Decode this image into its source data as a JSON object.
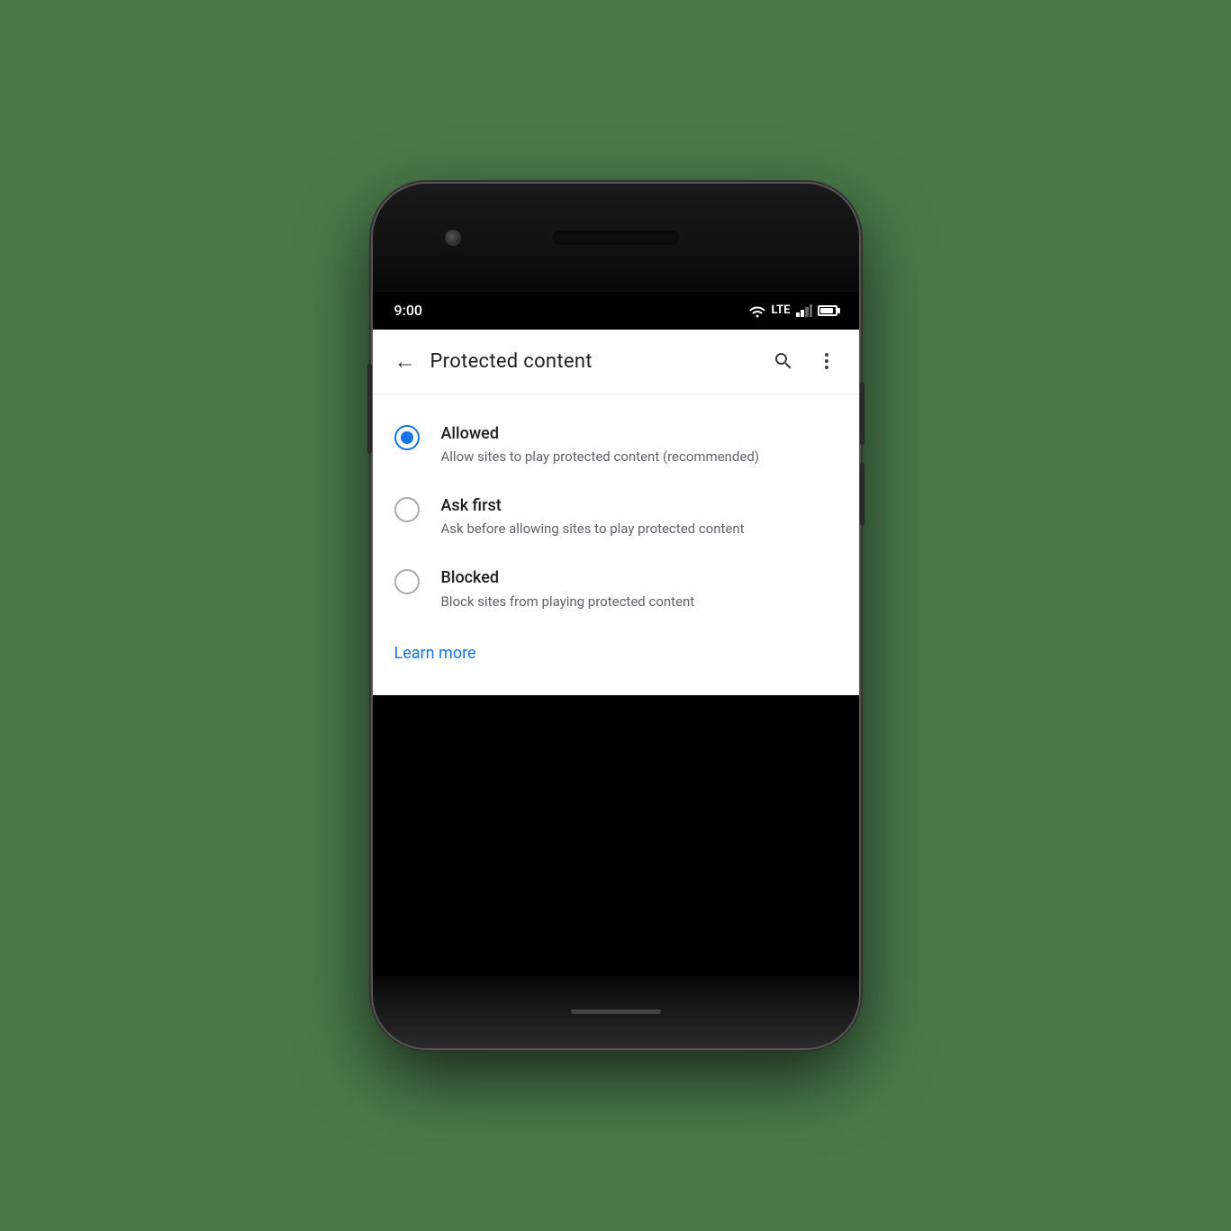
{
  "status_bar": {
    "time": "9:00",
    "lte_label": "LTE"
  },
  "app_bar": {
    "title": "Protected content",
    "back_label": "←",
    "search_tooltip": "Search",
    "more_tooltip": "More options"
  },
  "radio_options": [
    {
      "id": "allowed",
      "label": "Allowed",
      "description": "Allow sites to play protected content (recommended)",
      "selected": true
    },
    {
      "id": "ask_first",
      "label": "Ask first",
      "description": "Ask before allowing sites to play protected content",
      "selected": false
    },
    {
      "id": "blocked",
      "label": "Blocked",
      "description": "Block sites from playing protected content",
      "selected": false
    }
  ],
  "learn_more": {
    "label": "Learn more"
  }
}
